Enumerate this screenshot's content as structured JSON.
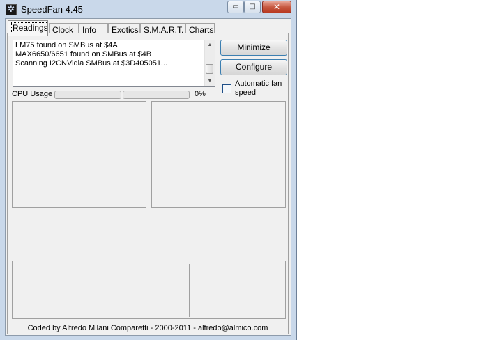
{
  "window": {
    "title": "SpeedFan 4.45",
    "controls": {
      "minimize_glyph": "▭",
      "maximize_glyph": "□",
      "close_glyph": "✕"
    }
  },
  "tabs": [
    {
      "label": "Readings",
      "active": true
    },
    {
      "label": "Clock",
      "active": false
    },
    {
      "label": "Info",
      "active": false
    },
    {
      "label": "Exotics",
      "active": false
    },
    {
      "label": "S.M.A.R.T.",
      "active": false
    },
    {
      "label": "Charts",
      "active": false
    }
  ],
  "log": {
    "lines": [
      "LM75 found on SMBus at $4A",
      "MAX6650/6651 found on SMBus at $4B",
      "Scanning I2CNVidia SMBus at $3D405051..."
    ]
  },
  "buttons": {
    "minimize": "Minimize",
    "configure": "Configure"
  },
  "automatic_fan_speed": {
    "label": "Automatic fan speed",
    "checked": false
  },
  "cpu_usage": {
    "label": "CPU Usage",
    "percent_text": "0%",
    "bar1_fill": 0,
    "bar2_fill": 0
  },
  "footer": "Coded by Alfredo Milani Comparetti - 2000-2011 - alfredo@almico.com",
  "colors": {
    "accent": "#3c7fb1",
    "frame": "#c9d8ea",
    "progress": "#06b025"
  },
  "icons": {
    "app": "speedfan-fan-icon"
  }
}
